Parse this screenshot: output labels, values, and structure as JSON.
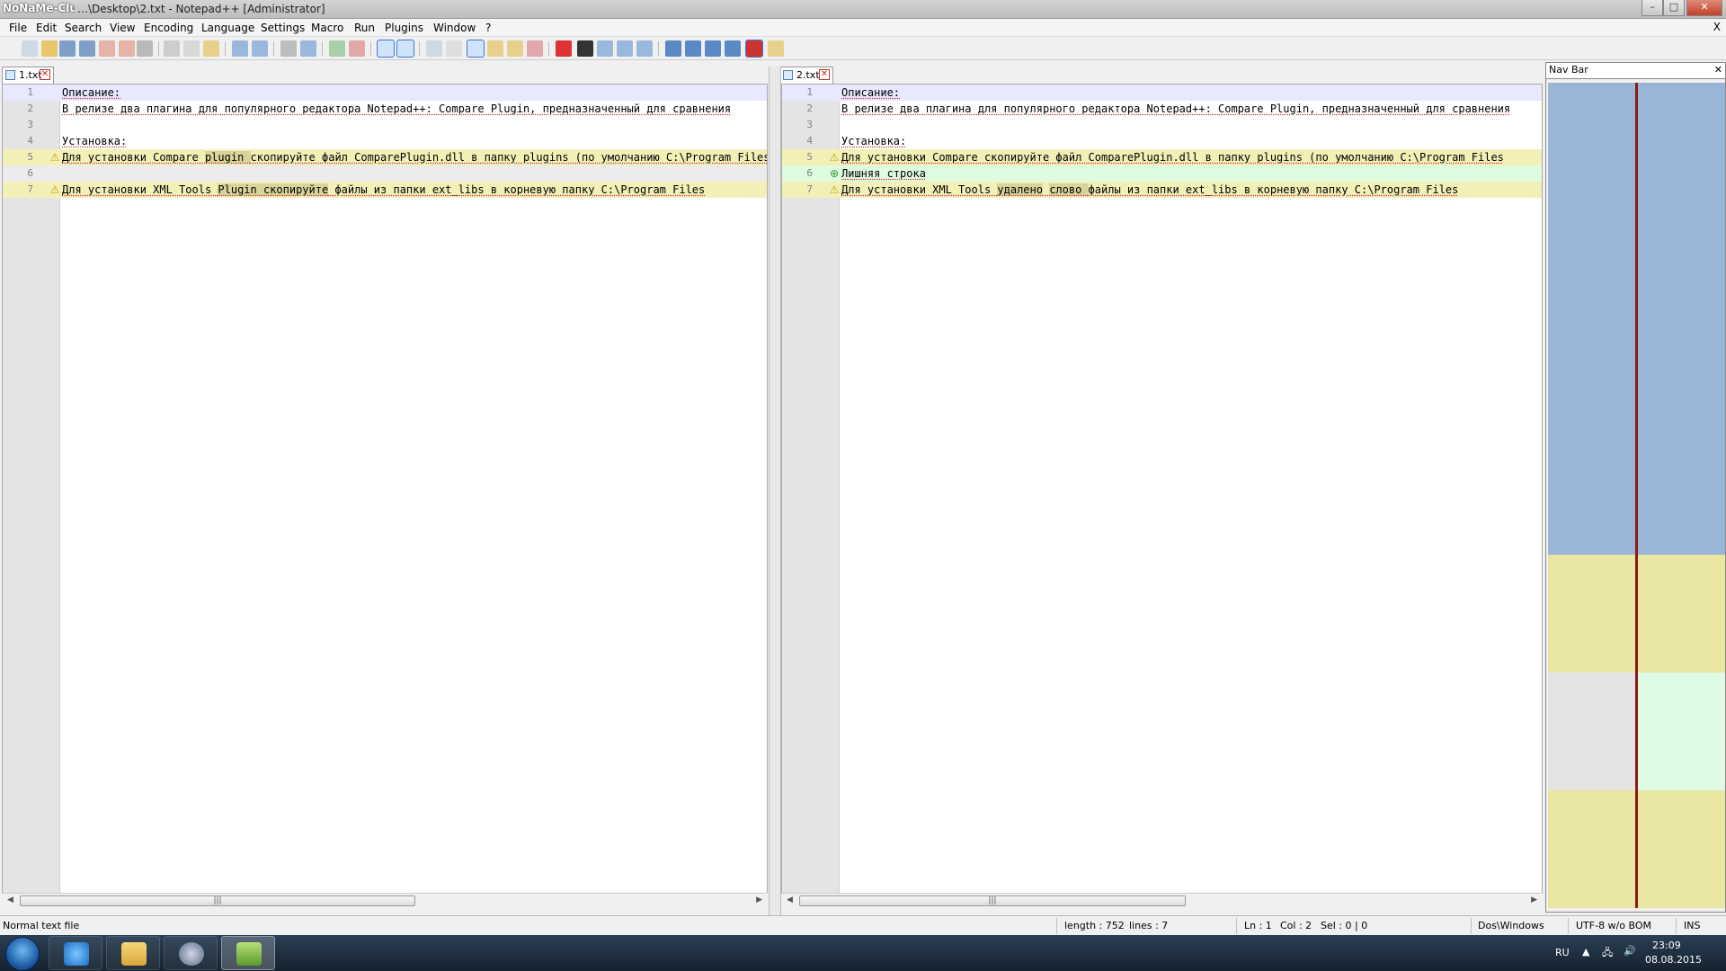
{
  "window": {
    "logo_text": "NoNaMe-Club",
    "title": "…\\Desktop\\2.txt - Notepad++ [Administrator]",
    "min_label": "–",
    "max_label": "□",
    "close_label": "✕"
  },
  "menu": {
    "items": [
      "File",
      "Edit",
      "Search",
      "View",
      "Encoding",
      "Language",
      "Settings",
      "Macro",
      "Run",
      "Plugins",
      "Window",
      "?"
    ],
    "close_label": "X"
  },
  "tabs": {
    "left": {
      "label": "1.txt",
      "close": "✕"
    },
    "right": {
      "label": "2.txt",
      "close": "✕"
    }
  },
  "left_editor": {
    "lines": [
      {
        "num": "1",
        "text": "Описание:",
        "state": "current",
        "marker": ""
      },
      {
        "num": "2",
        "text": "В релизе два плагина для популярного редактора Notepad++: Compare Plugin, предназначенный для сравнения",
        "state": "normal",
        "marker": ""
      },
      {
        "num": "3",
        "text": "",
        "state": "normal",
        "marker": ""
      },
      {
        "num": "4",
        "text": "Установка:",
        "state": "normal",
        "marker": ""
      },
      {
        "num": "5",
        "before": "Для установки Compare ",
        "hl": "plugin ",
        "after": "скопируйте файл ComparePlugin.dll в папку plugins (по умолчанию C:\\Program Files",
        "state": "changed",
        "marker": "warn"
      },
      {
        "num": "6",
        "text": "",
        "state": "blank",
        "marker": ""
      },
      {
        "num": "7",
        "before": "Для установки XML Tools ",
        "hl": "Plugin  скопируйте",
        "after": " файлы из папки ext_libs в корневую папку C:\\Program Files",
        "state": "changed",
        "marker": "warn"
      }
    ]
  },
  "right_editor": {
    "lines": [
      {
        "num": "1",
        "text": "Описание:",
        "state": "current",
        "marker": ""
      },
      {
        "num": "2",
        "text": "В релизе два плагина для популярного редактора Notepad++: Compare Plugin, предназначенный для сравнения",
        "state": "normal",
        "marker": ""
      },
      {
        "num": "3",
        "text": "",
        "state": "normal",
        "marker": ""
      },
      {
        "num": "4",
        "text": "Установка:",
        "state": "normal",
        "marker": ""
      },
      {
        "num": "5",
        "text": "Для установки Compare скопируйте файл ComparePlugin.dll в папку plugins (по умолчанию C:\\Program Files",
        "state": "changed",
        "marker": "warn"
      },
      {
        "num": "6",
        "text": "Лишняя строка",
        "state": "added",
        "marker": "add"
      },
      {
        "num": "7",
        "before": "Для установки XML Tools ",
        "hl": "удалено",
        "mid": " ",
        "hl2": "слово ",
        "after": " файлы из папки ext_libs в корневую папку C:\\Program Files",
        "state": "changed",
        "marker": "warn"
      }
    ]
  },
  "scroll_grip": "|||",
  "navbar": {
    "title": "Nav Bar",
    "close_label": "✕",
    "colors": {
      "normal": "#9bb5d6",
      "changed": "#e8e6a0",
      "blank": "#e4e4e4",
      "added": "#e0fbe3",
      "divider": "#8a1a1a"
    }
  },
  "status": {
    "file_type": "Normal text file",
    "length": "length : 752",
    "lines": "lines : 7",
    "ln": "Ln : 1",
    "col": "Col : 2",
    "sel": "Sel : 0 | 0",
    "eol": "Dos\\Windows",
    "encoding": "UTF-8 w/o BOM",
    "mode": "INS"
  },
  "taskbar": {
    "lang": "RU",
    "time": "23:09",
    "date": "08.08.2015"
  },
  "colors": {
    "current_line": "#e8e8ff",
    "changed_line": "#f2efb7",
    "added_line": "#dffbe0",
    "blank_line": "#ececec",
    "word_highlight": "#d9d59a"
  }
}
